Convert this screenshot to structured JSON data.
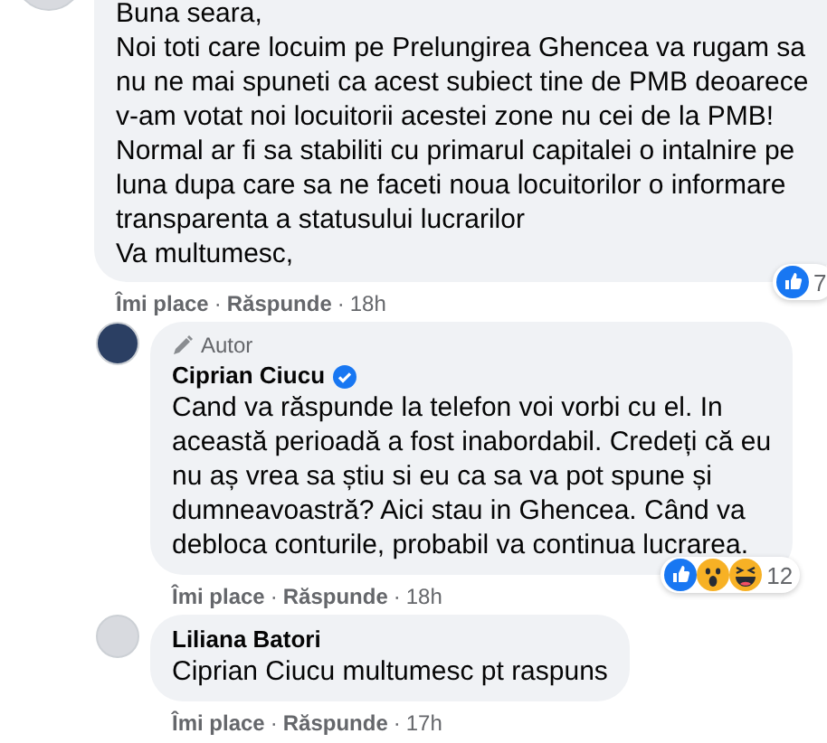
{
  "comments": [
    {
      "verified": false,
      "lines": [
        "Buna seara,",
        "Noi toti care locuim pe Prelungirea Ghencea va rugam sa",
        "nu ne mai spuneti ca acest subiect tine de PMB deoarece",
        "v-am votat noi locuitorii acestei zone nu cei de la PMB!",
        "Normal ar fi sa stabiliti cu primarul capitalei o intalnire pe",
        "luna dupa care sa ne faceti noua locuitorilor o informare",
        "transparenta a statusului lucrarilor",
        "Va multumesc,"
      ],
      "reactions": {
        "icons": [
          {
            "kind": "like"
          }
        ],
        "count": "7"
      },
      "actions": [
        "Îmi place",
        "Răspunde"
      ],
      "separator": "·",
      "time": "18h",
      "reply": false
    },
    {
      "author": "Ciprian Ciucu",
      "badge": "Autor",
      "verified": true,
      "lines": [
        "Cand va răspunde la telefon voi vorbi cu el. In",
        "această perioadă a fost inabordabil. Credeți că eu",
        "nu aș vrea sa știu si eu ca sa va pot spune și",
        "dumneavoastră? Aici stau in Ghencea. Când va",
        "debloca conturile, probabil va continua lucrarea."
      ],
      "reactions": {
        "icons": [
          {
            "kind": "like"
          },
          {
            "kind": "wow"
          },
          {
            "kind": "haha"
          }
        ],
        "count": "12"
      },
      "actions": [
        "Îmi place",
        "Răspunde"
      ],
      "separator": "·",
      "time": "18h",
      "reply": true
    },
    {
      "author": "Liliana Batori",
      "verified": false,
      "lines": [
        "Ciprian Ciucu multumesc pt raspuns"
      ],
      "actions": [
        "Îmi place",
        "Răspunde"
      ],
      "separator": "·",
      "time": "17h",
      "reply": true
    }
  ]
}
